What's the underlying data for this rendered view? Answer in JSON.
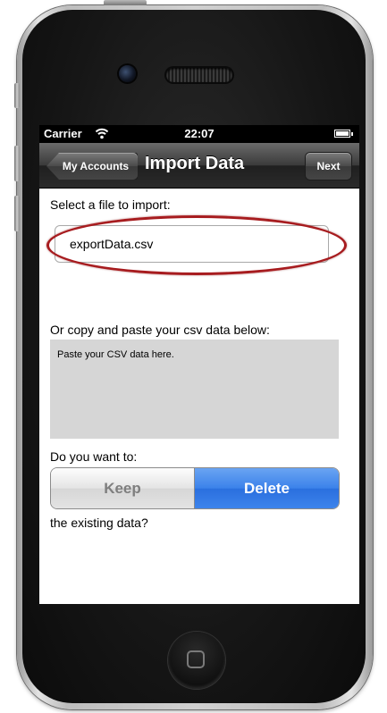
{
  "status_bar": {
    "carrier": "Carrier",
    "time": "22:07"
  },
  "nav_bar": {
    "back_label": "My Accounts",
    "title": "Import Data",
    "next_label": "Next"
  },
  "import_form": {
    "select_file_label": "Select a file to import:",
    "file_value": "exportData.csv",
    "paste_label": "Or copy and paste your csv data below:",
    "paste_placeholder": "Paste your CSV data here.",
    "question_label": "Do you want to:",
    "options": [
      "Keep",
      "Delete"
    ],
    "selected_option": "Delete",
    "suffix_label": "the existing data?"
  },
  "colors": {
    "selected_segment": "#3b82ea",
    "highlight_ring": "#a71c1f",
    "csv_area": "#d6d6d6"
  }
}
